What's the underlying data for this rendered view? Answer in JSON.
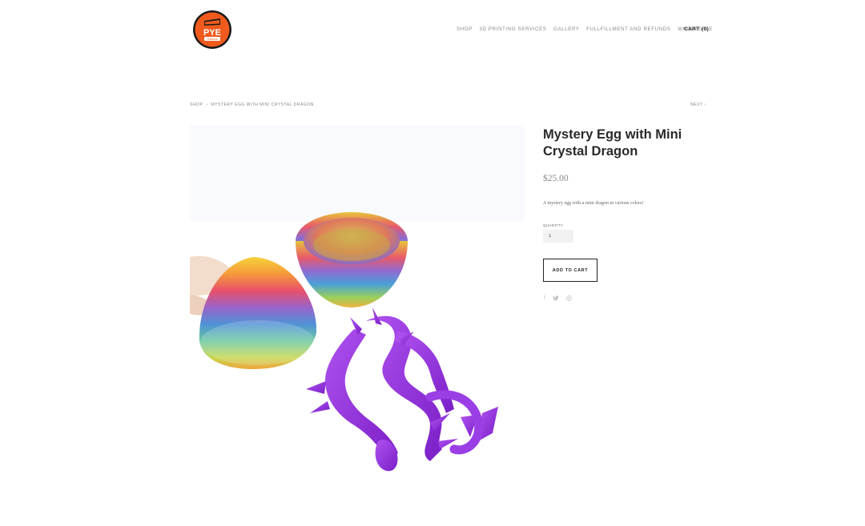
{
  "brand": {
    "logo_top": "PYE",
    "logo_bottom": "Games",
    "colors": {
      "logo_orange": "#F05A1C",
      "logo_black": "#1A1A1A"
    }
  },
  "nav": {
    "items": [
      {
        "label": "SHOP"
      },
      {
        "label": "3D PRINTING SERVICES"
      },
      {
        "label": "GALLERY"
      },
      {
        "label": "FULLFILLMENT AND REFUNDS"
      },
      {
        "label": "WHOLESALE"
      }
    ],
    "cart_label": "CART (0)"
  },
  "breadcrumb": {
    "shop": "SHOP",
    "separator": "›",
    "current": "MYSTERY EGG WITH MINI CRYSTAL DRAGON",
    "next": "NEXT ›"
  },
  "product": {
    "title": "Mystery Egg with Mini Crystal Dragon",
    "price": "$25.00",
    "description": "A mystery egg with a mini dragon in various colors!",
    "quantity_label": "QUANTITY",
    "quantity_value": "1",
    "add_to_cart": "ADD TO CART",
    "image_icon": "product-photo"
  },
  "share": {
    "icons": [
      "facebook-icon",
      "twitter-icon",
      "pinterest-icon"
    ],
    "facebook": "f",
    "twitter": "t",
    "pinterest": "p"
  }
}
